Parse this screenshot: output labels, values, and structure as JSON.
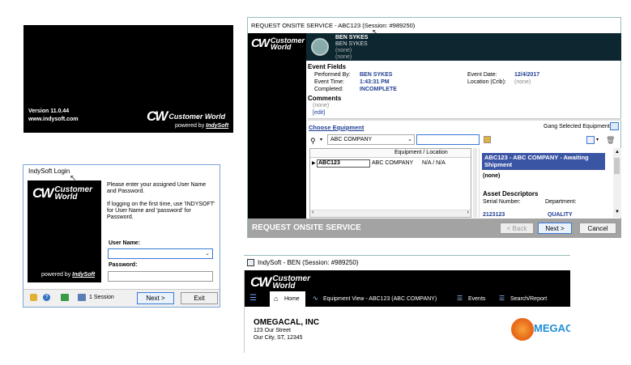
{
  "splash": {
    "version": "Version 11.0.44",
    "website": "www.indysoft.com",
    "brand_line1": "Customer",
    "brand_line2": "World",
    "brand_inline": "Customer World",
    "powered": "powered by",
    "powered_brand": "IndySoft"
  },
  "login": {
    "title": "IndySoft Login",
    "instructions": "Please enter your assigned User Name and Password.",
    "first_time": "If logging on the first time, use 'INDYSOFT' for User Name and 'password' for Password.",
    "username_label": "User Name:",
    "username_value": "",
    "password_label": "Password:",
    "password_value": "",
    "session_text": "1 Session",
    "next_label": "Next >",
    "exit_label": "Exit",
    "powered": "powered by",
    "powered_brand": "IndySoft"
  },
  "onsite": {
    "title": "REQUEST ONSITE SERVICE - ABC123 (Session: #989250)",
    "user_name": "BEN SYKES",
    "user_sub1": "BEN SYKES",
    "user_sub2": "(none)",
    "user_sub3": "(none)",
    "event_fields_title": "Event Fields",
    "performed_by_label": "Performed By:",
    "performed_by": "BEN SYKES",
    "event_time_label": "Event Time:",
    "event_time": "1:43:31 PM",
    "completed_label": "Completed:",
    "completed": "INCOMPLETE",
    "event_date_label": "Event Date:",
    "event_date": "12/4/2017",
    "location_label": "Location (Crib):",
    "location": "(none)",
    "comments_title": "Comments",
    "comments_value": "(none)",
    "edit_link": "[edit]",
    "choose_equipment": "Choose Equipment",
    "gang_selected": "Gang Selected Equipment",
    "company_select": "ABC COMPANY",
    "search_value": "",
    "grid_header": "Equipment / Location",
    "grid_rows": [
      {
        "id": "ABC123",
        "company": "ABC COMPANY",
        "location": "N/A / N/A"
      }
    ],
    "detail_title": "ABC123 - ABC COMPANY - Awaiting Shipment",
    "detail_none": "(none)",
    "asset_descriptors": "Asset Descriptors",
    "serial_label": "Serial Number:",
    "department_label": "Department:",
    "serial_partial": "2123123",
    "department_partial": "QUALITY",
    "footer_title": "REQUEST ONSITE SERVICE",
    "back_label": "< Back",
    "next_label": "Next >",
    "cancel_label": "Cancel"
  },
  "main": {
    "title": "IndySoft - BEN (Session: #989250)",
    "nav": [
      {
        "label": "Home"
      },
      {
        "label": "Equipment View - ABC123 (ABC COMPANY)"
      },
      {
        "label": "Events"
      },
      {
        "label": "Search/Report"
      }
    ],
    "company_name": "OMEGACAL, INC",
    "address1": "123 Our Street",
    "address2": "Our City, ST, 12345",
    "logo_text": "MEGAC"
  },
  "colors": {
    "dark_header": "#0d2730",
    "accent_blue": "#1f3e93",
    "selection": "#3b55a5"
  }
}
